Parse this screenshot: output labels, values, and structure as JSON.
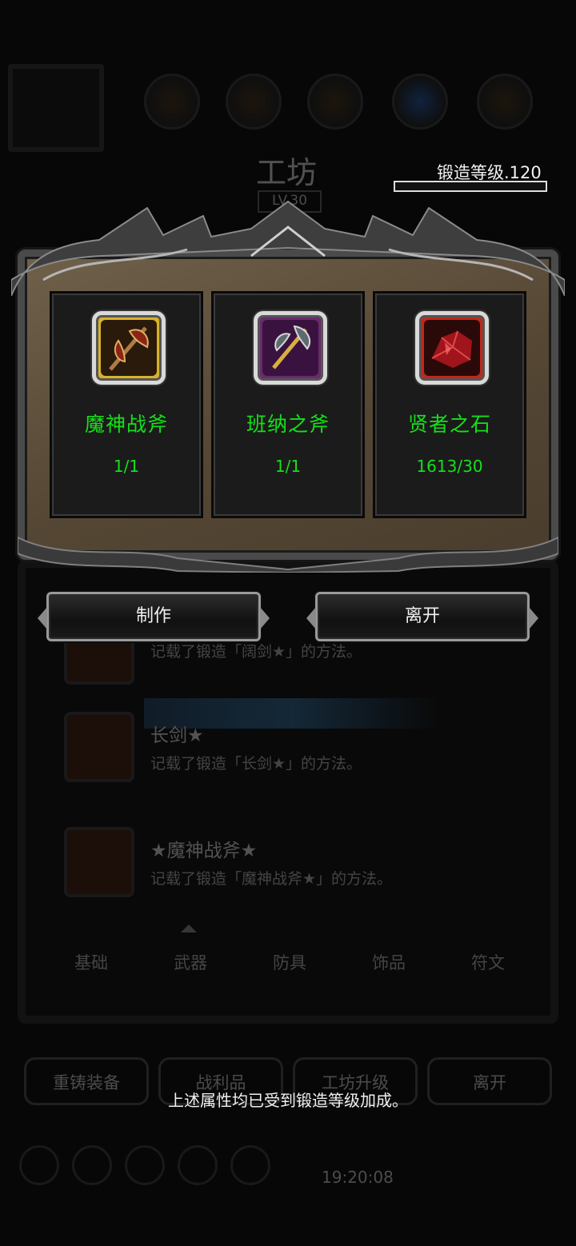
{
  "background": {
    "title": "工坊",
    "level": "LV.30",
    "recipes": [
      {
        "name": "",
        "desc": "记载了锻造「阔剑★」的方法。"
      },
      {
        "name": "长剑★",
        "desc": "记载了锻造「长剑★」的方法。"
      },
      {
        "name": "★魔神战斧★",
        "desc": "记载了锻造「魔神战斧★」的方法。"
      }
    ],
    "tabs": [
      "基础",
      "武器",
      "防具",
      "饰品",
      "符文"
    ],
    "buttons": [
      "重铸装备",
      "战利品",
      "工坊升级",
      "离开"
    ],
    "clock": "19:20:08"
  },
  "forge": {
    "level_text": "锻造等级.120",
    "progress": 0
  },
  "materials": [
    {
      "name": "魔神战斧",
      "count": "1/1",
      "icon": "demon-axe-icon",
      "frame_color": "#d6b32a"
    },
    {
      "name": "班纳之斧",
      "count": "1/1",
      "icon": "banna-axe-icon",
      "frame_color": "#6a2a6e"
    },
    {
      "name": "贤者之石",
      "count": "1613/30",
      "icon": "sage-stone-icon",
      "frame_color": "#c0281a"
    }
  ],
  "actions": {
    "craft": "制作",
    "leave": "离开"
  },
  "toast": "上述属性均已受到锻造等级加成。"
}
